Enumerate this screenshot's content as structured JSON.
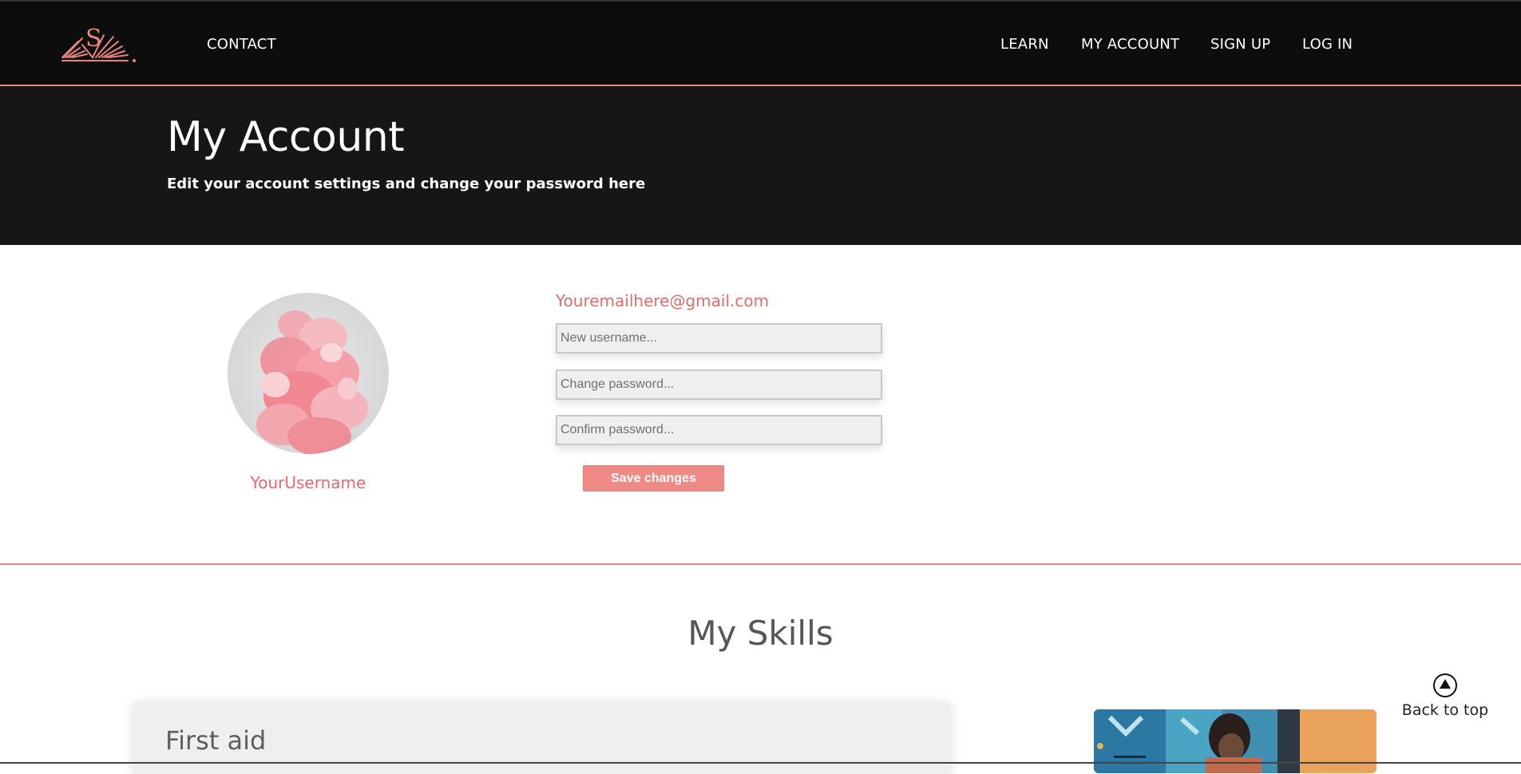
{
  "colors": {
    "accent": "#e46b69",
    "button": "#f08a87",
    "nav_background": "#0d0d0d",
    "hero_background": "#171617"
  },
  "nav": {
    "logo_icon": "open-book-s-logo-icon",
    "left_links": [
      "CONTACT"
    ],
    "right_links": [
      "LEARN",
      "MY ACCOUNT",
      "SIGN UP",
      "LOG IN"
    ]
  },
  "hero": {
    "title": "My Account",
    "subtitle": "Edit your account settings and change your password here"
  },
  "profile": {
    "username": "YourUsername",
    "email": "Youremailhere@gmail.com"
  },
  "form": {
    "username_placeholder": "New username...",
    "password_placeholder": "Change password...",
    "confirm_placeholder": "Confirm password...",
    "save_label": "Save changes"
  },
  "skills": {
    "heading": "My Skills",
    "items": [
      {
        "title": "First aid"
      }
    ]
  },
  "back_to_top": {
    "label": "Back to top",
    "icon": "arrow-up-circle-icon"
  }
}
